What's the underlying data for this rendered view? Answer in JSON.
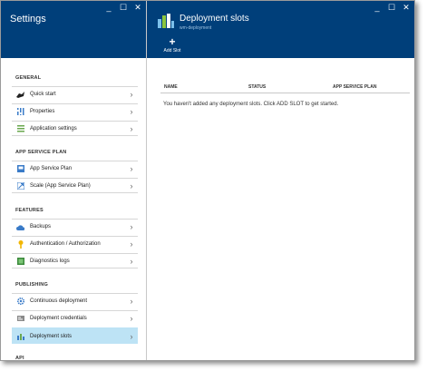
{
  "settings": {
    "title": "Settings",
    "window_controls": [
      "_",
      "☐",
      "✕"
    ],
    "sections": [
      {
        "label": "GENERAL",
        "items": [
          {
            "label": "Quick start",
            "icon": "rocket-icon"
          },
          {
            "label": "Properties",
            "icon": "properties-icon"
          },
          {
            "label": "Application settings",
            "icon": "settings-list-icon"
          }
        ]
      },
      {
        "label": "APP SERVICE PLAN",
        "items": [
          {
            "label": "App Service Plan",
            "icon": "app-service-plan-icon"
          },
          {
            "label": "Scale (App Service Plan)",
            "icon": "scale-icon"
          }
        ]
      },
      {
        "label": "FEATURES",
        "items": [
          {
            "label": "Backups",
            "icon": "cloud-backup-icon"
          },
          {
            "label": "Authentication / Authorization",
            "icon": "key-icon"
          },
          {
            "label": "Diagnostics logs",
            "icon": "diagnostics-icon"
          }
        ]
      },
      {
        "label": "PUBLISHING",
        "items": [
          {
            "label": "Continuous deployment",
            "icon": "gear-icon"
          },
          {
            "label": "Deployment credentials",
            "icon": "credentials-icon"
          },
          {
            "label": "Deployment slots",
            "icon": "deployment-slots-icon",
            "selected": true
          }
        ]
      },
      {
        "label": "API",
        "items": []
      }
    ]
  },
  "slots": {
    "title": "Deployment slots",
    "subtitle": "wm-deployment",
    "window_controls": [
      "_",
      "☐",
      "✕"
    ],
    "add_slot_label": "Add Slot",
    "add_slot_icon": "+",
    "columns": [
      "NAME",
      "STATUS",
      "APP SERVICE PLAN"
    ],
    "empty_message": "You haven't added any deployment slots. Click ADD SLOT to get started."
  },
  "colors": {
    "header_blue": "#003f7a",
    "selected_row": "#bde3f5"
  }
}
